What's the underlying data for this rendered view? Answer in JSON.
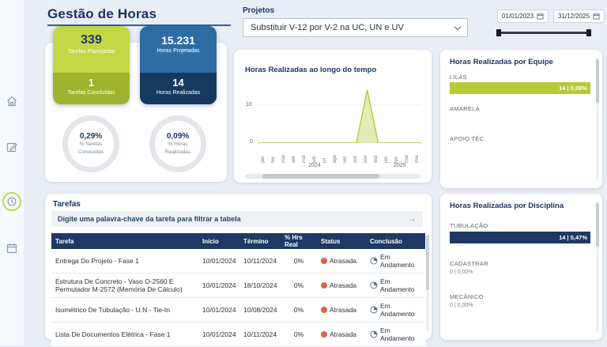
{
  "colors": {
    "navy": "#1f3864",
    "accent_green": "#b5ca35",
    "card_green_top": "#c3d644",
    "card_green_bottom": "#9fb42c",
    "card_blue_top": "#2e6da4",
    "card_blue_bottom": "#16395f",
    "status_red": "#e2614d"
  },
  "header": {
    "title": "Gestão de Horas",
    "projects_label": "Projetos",
    "projects_value": "Substituir V-12 por V-2 na UC, UN e UV",
    "date_start": "01/01/2023",
    "date_end": "31/12/2025"
  },
  "kpi": {
    "planned": {
      "value": "339",
      "label": "Tarefas Planejadas"
    },
    "concluded": {
      "value": "1",
      "label": "Tarefas Concluídas"
    },
    "projected": {
      "value": "15.231",
      "label": "Horas Projetadas"
    },
    "realized": {
      "value": "14",
      "label": "Horas Realizadas"
    },
    "pct_tasks": {
      "value": "0,29%",
      "line1": "% Tarefas",
      "line2": "Concluídas"
    },
    "pct_hours": {
      "value": "0,09%",
      "line1": "% Horas",
      "line2": "Realizadas"
    }
  },
  "chart_data": {
    "type": "area",
    "title": "Horas Realizadas ao longo do tempo",
    "x_labels": [
      "jan",
      "fev",
      "mar",
      "abr",
      "mai",
      "jun",
      "jul",
      "ago",
      "set",
      "out",
      "nov",
      "dez",
      "jan",
      "fev",
      "mar",
      "mai"
    ],
    "values": [
      0,
      0,
      0,
      0,
      0,
      0,
      0,
      0,
      0,
      0,
      14,
      0,
      0,
      0,
      0,
      0
    ],
    "yticks": [
      "10",
      "0"
    ],
    "ylim": [
      0,
      15
    ],
    "year_groups": [
      {
        "label": "2024"
      },
      {
        "label": "2025"
      }
    ],
    "series_color": "#b5ca35",
    "fill_color": "#dde8a8",
    "grid": true,
    "legend": "none"
  },
  "equipe": {
    "title": "Horas Realizadas por Equipe",
    "chart": {
      "type": "bar",
      "categories": [
        "LILÁS",
        "AMARELA",
        "APOIO TÉC."
      ],
      "values": [
        14,
        0,
        0
      ]
    },
    "items": [
      {
        "label": "LILÁS",
        "value_text": "14 | 0,09%",
        "bar_pct": 100
      },
      {
        "label": "AMARELA"
      },
      {
        "label": "APOIO TÉC."
      }
    ]
  },
  "tarefas": {
    "title": "Tarefas",
    "search_placeholder": "Digite uma palavra-chave da tarefa para filtrar a tabela",
    "search_arrow": "→",
    "columns": [
      "Tarefa",
      "Início",
      "Término",
      "% Hrs Real",
      "Status",
      "Conclusão"
    ],
    "rows": [
      {
        "tarefa": "Entrega Do Projeto - Fase 1",
        "inicio": "10/01/2024",
        "termino": "10/11/2024",
        "pct": "0%",
        "status": "Atrasada",
        "conclusao": "Em Andamento"
      },
      {
        "tarefa": "Estrutura De Concreto - Vaso O-2560 E Permutador M-2572 (Memória De Cálculo)",
        "inicio": "10/01/2024",
        "termino": "18/10/2024",
        "pct": "0%",
        "status": "Atrasada",
        "conclusao": "Em Andamento"
      },
      {
        "tarefa": "Isométrico De Tubulação - U.N - Tie-In",
        "inicio": "10/01/2024",
        "termino": "10/08/2024",
        "pct": "0%",
        "status": "Atrasada",
        "conclusao": "Em Andamento"
      },
      {
        "tarefa": "Lista De Documentos Elétrica - Fase 1",
        "inicio": "10/01/2024",
        "termino": "10/11/2024",
        "pct": "0%",
        "status": "Atrasada",
        "conclusao": "Em Andamento"
      }
    ]
  },
  "disciplina": {
    "title": "Horas Realizadas por Disciplina",
    "chart": {
      "type": "bar",
      "categories": [
        "TUBULAÇÃO",
        "CADASTRAR",
        "MECÂNICO"
      ],
      "values": [
        14,
        0,
        0
      ]
    },
    "items": [
      {
        "label": "TUBULAÇÃO",
        "value_text": "14 | 5,47%",
        "bar_pct": 100
      },
      {
        "label": "CADASTRAR",
        "value_text": "0 | 0,00%"
      },
      {
        "label": "MECÂNICO",
        "value_text": "0 | 0,00%"
      }
    ]
  }
}
